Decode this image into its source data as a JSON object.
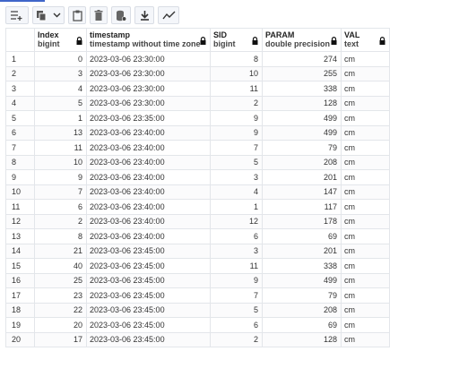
{
  "toolbar": {
    "buttons": [
      "add-row-icon",
      "copy-icon",
      "chevron-down-icon",
      "paste-icon",
      "delete-icon",
      "save-data-icon",
      "download-icon",
      "graph-icon"
    ]
  },
  "grid": {
    "columns": [
      {
        "name": "Index",
        "type": "bigint"
      },
      {
        "name": "timestamp",
        "type": "timestamp without time zone"
      },
      {
        "name": "SID",
        "type": "bigint"
      },
      {
        "name": "PARAM",
        "type": "double precision"
      },
      {
        "name": "VAL",
        "type": "text"
      }
    ],
    "rows": [
      [
        "1",
        "0",
        "2023-03-06 23:30:00",
        "8",
        "274",
        "cm"
      ],
      [
        "2",
        "3",
        "2023-03-06 23:30:00",
        "10",
        "255",
        "cm"
      ],
      [
        "3",
        "4",
        "2023-03-06 23:30:00",
        "11",
        "338",
        "cm"
      ],
      [
        "4",
        "5",
        "2023-03-06 23:30:00",
        "2",
        "128",
        "cm"
      ],
      [
        "5",
        "1",
        "2023-03-06 23:35:00",
        "9",
        "499",
        "cm"
      ],
      [
        "6",
        "13",
        "2023-03-06 23:40:00",
        "9",
        "499",
        "cm"
      ],
      [
        "7",
        "11",
        "2023-03-06 23:40:00",
        "7",
        "79",
        "cm"
      ],
      [
        "8",
        "10",
        "2023-03-06 23:40:00",
        "5",
        "208",
        "cm"
      ],
      [
        "9",
        "9",
        "2023-03-06 23:40:00",
        "3",
        "201",
        "cm"
      ],
      [
        "10",
        "7",
        "2023-03-06 23:40:00",
        "4",
        "147",
        "cm"
      ],
      [
        "11",
        "6",
        "2023-03-06 23:40:00",
        "1",
        "117",
        "cm"
      ],
      [
        "12",
        "2",
        "2023-03-06 23:40:00",
        "12",
        "178",
        "cm"
      ],
      [
        "13",
        "8",
        "2023-03-06 23:40:00",
        "6",
        "69",
        "cm"
      ],
      [
        "14",
        "21",
        "2023-03-06 23:45:00",
        "3",
        "201",
        "cm"
      ],
      [
        "15",
        "40",
        "2023-03-06 23:45:00",
        "11",
        "338",
        "cm"
      ],
      [
        "16",
        "25",
        "2023-03-06 23:45:00",
        "9",
        "499",
        "cm"
      ],
      [
        "17",
        "23",
        "2023-03-06 23:45:00",
        "7",
        "79",
        "cm"
      ],
      [
        "18",
        "22",
        "2023-03-06 23:45:00",
        "5",
        "208",
        "cm"
      ],
      [
        "19",
        "20",
        "2023-03-06 23:45:00",
        "6",
        "69",
        "cm"
      ],
      [
        "20",
        "17",
        "2023-03-06 23:45:00",
        "2",
        "128",
        "cm"
      ]
    ]
  }
}
